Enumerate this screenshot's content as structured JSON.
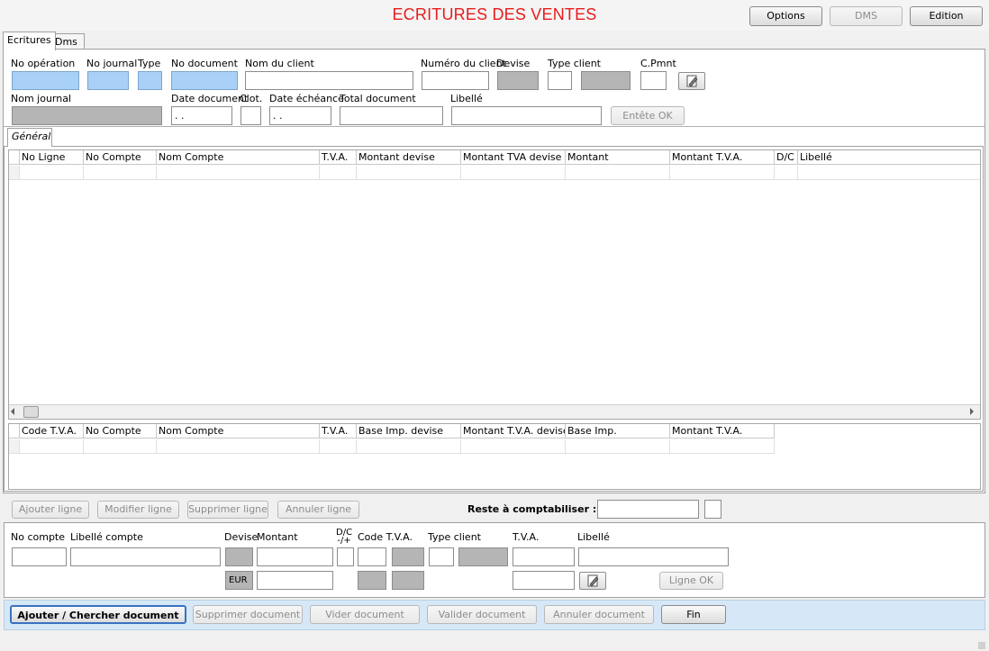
{
  "window": {
    "title": "ECRITURES DES VENTES"
  },
  "toolbar": {
    "options": "Options",
    "dms": "DMS",
    "edition": "Edition"
  },
  "tabs": [
    {
      "label": "Ecritures"
    },
    {
      "label": "Dms"
    }
  ],
  "header": {
    "no_operation": "No opération",
    "no_journal": "No journal",
    "type": "Type",
    "no_document": "No document",
    "nom_client": "Nom du client",
    "numero_client": "Numéro du client",
    "devise": "Devise",
    "type_client": "Type client",
    "c_pmnt": "C.Pmnt",
    "nom_journal": "Nom journal",
    "date_document": "Date document",
    "clot": "Clot.",
    "date_echeance": "Date échéance",
    "total_document": "Total document",
    "libelle": "Libellé",
    "date_document_value": " .  .",
    "date_echeance_value": " .  .",
    "entete_ok": "Entête OK"
  },
  "subtab": {
    "label": "Général"
  },
  "lines_grid": {
    "columns": [
      "No Ligne",
      "No Compte",
      "Nom Compte",
      "T.V.A.",
      "Montant devise",
      "Montant TVA devise",
      "Montant",
      "Montant T.V.A.",
      "D/C",
      "Libellé"
    ]
  },
  "vat_grid": {
    "columns": [
      "Code T.V.A.",
      "No Compte",
      "Nom Compte",
      "T.V.A.",
      "Base Imp. devise",
      "Montant T.V.A. devise",
      "Base Imp.",
      "Montant T.V.A."
    ]
  },
  "line_actions": {
    "add": "Ajouter ligne",
    "modify": "Modifier ligne",
    "delete": "Supprimer ligne",
    "cancel": "Annuler ligne",
    "reste_label": "Reste à comptabiliser :"
  },
  "line_entry": {
    "no_compte": "No compte",
    "libelle_compte": "Libellé compte",
    "devise": "Devise",
    "montant": "Montant",
    "dc": "D/C",
    "dc_sub": "-/+",
    "code_tva": "Code T.V.A.",
    "type_client": "Type client",
    "tva": "T.V.A.",
    "libelle": "Libellé",
    "currency": "EUR",
    "ligne_ok": "Ligne OK"
  },
  "document_actions": {
    "add_search": "Ajouter / Chercher document",
    "delete": "Supprimer document",
    "empty": "Vider document",
    "validate": "Valider document",
    "cancel": "Annuler document",
    "end": "Fin"
  },
  "icons": {
    "pen": "pen-icon"
  }
}
